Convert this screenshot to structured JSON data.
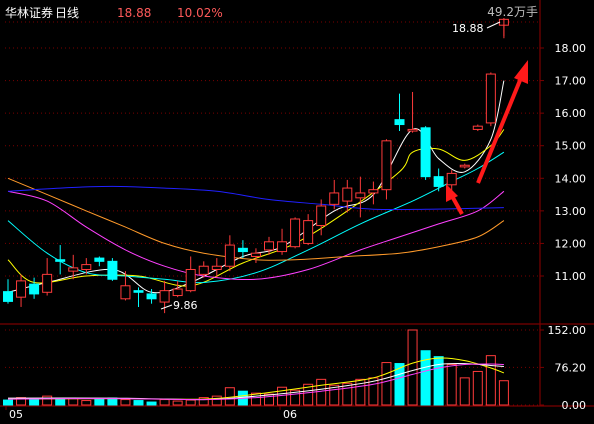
{
  "header": {
    "stock_name": "华林证券",
    "period": "日线",
    "price": "18.88",
    "change_pct": "10.02%",
    "volume_label": "49.2万手"
  },
  "colors": {
    "background": "#000000",
    "up": "#ff3b3b",
    "down": "#00ffff",
    "grid": "#7a0000",
    "axis_text": "#ffffff",
    "header_name": "#ffffff",
    "header_value": "#ff5a5a",
    "arrow": "#ff1a1a",
    "ma_fast": "#ffffff",
    "ma_yellow": "#ffff00",
    "ma_cyan": "#00ffff",
    "ma_magenta": "#ff40ff",
    "ma_orange": "#ff9a2a",
    "ma_blue": "#2020ff"
  },
  "chart_data": {
    "type": "candlestick",
    "price_axis": {
      "ticks": [
        "18.00",
        "17.00",
        "16.00",
        "15.00",
        "14.00",
        "13.00",
        "12.00",
        "11.00"
      ],
      "range": [
        10.0,
        19.0
      ]
    },
    "volume_axis": {
      "ticks": [
        "152.00",
        "76.20",
        "0.00"
      ],
      "range": [
        0,
        152
      ],
      "unit": "万手"
    },
    "x_labels": [
      {
        "text": "05",
        "index": 0
      },
      {
        "text": "06",
        "index": 21
      }
    ],
    "annotations": {
      "high_label": "18.88",
      "low_label": "9.86"
    },
    "candles": [
      {
        "o": 10.52,
        "h": 10.9,
        "l": 10.15,
        "c": 10.22,
        "v": 10
      },
      {
        "o": 10.35,
        "h": 11.05,
        "l": 10.05,
        "c": 10.85,
        "v": 15
      },
      {
        "o": 10.75,
        "h": 10.95,
        "l": 10.3,
        "c": 10.45,
        "v": 12
      },
      {
        "o": 10.5,
        "h": 11.55,
        "l": 10.4,
        "c": 11.05,
        "v": 18
      },
      {
        "o": 11.5,
        "h": 11.95,
        "l": 11.05,
        "c": 11.45,
        "v": 14
      },
      {
        "o": 11.15,
        "h": 11.65,
        "l": 10.9,
        "c": 11.25,
        "v": 13
      },
      {
        "o": 11.2,
        "h": 11.55,
        "l": 11.05,
        "c": 11.35,
        "v": 9
      },
      {
        "o": 11.55,
        "h": 11.6,
        "l": 11.3,
        "c": 11.45,
        "v": 12
      },
      {
        "o": 11.45,
        "h": 11.55,
        "l": 10.85,
        "c": 10.9,
        "v": 14
      },
      {
        "o": 10.3,
        "h": 11.15,
        "l": 10.25,
        "c": 10.7,
        "v": 11
      },
      {
        "o": 10.55,
        "h": 10.65,
        "l": 10.05,
        "c": 10.5,
        "v": 9
      },
      {
        "o": 10.45,
        "h": 10.6,
        "l": 10.15,
        "c": 10.3,
        "v": 6
      },
      {
        "o": 10.2,
        "h": 10.85,
        "l": 9.86,
        "c": 10.55,
        "v": 11
      },
      {
        "o": 10.4,
        "h": 10.85,
        "l": 10.35,
        "c": 10.6,
        "v": 8
      },
      {
        "o": 10.55,
        "h": 11.6,
        "l": 10.5,
        "c": 11.2,
        "v": 10
      },
      {
        "o": 11.05,
        "h": 11.45,
        "l": 10.95,
        "c": 11.3,
        "v": 15
      },
      {
        "o": 11.2,
        "h": 11.55,
        "l": 10.95,
        "c": 11.3,
        "v": 18
      },
      {
        "o": 11.3,
        "h": 12.25,
        "l": 11.15,
        "c": 11.95,
        "v": 35
      },
      {
        "o": 11.85,
        "h": 12.1,
        "l": 11.55,
        "c": 11.75,
        "v": 28
      },
      {
        "o": 11.6,
        "h": 11.85,
        "l": 11.4,
        "c": 11.7,
        "v": 24
      },
      {
        "o": 11.8,
        "h": 12.2,
        "l": 11.65,
        "c": 12.05,
        "v": 22
      },
      {
        "o": 11.75,
        "h": 12.45,
        "l": 11.65,
        "c": 12.05,
        "v": 36
      },
      {
        "o": 11.9,
        "h": 12.8,
        "l": 11.85,
        "c": 12.75,
        "v": 30
      },
      {
        "o": 12.0,
        "h": 12.9,
        "l": 11.95,
        "c": 12.7,
        "v": 42
      },
      {
        "o": 12.55,
        "h": 13.35,
        "l": 12.25,
        "c": 13.15,
        "v": 52
      },
      {
        "o": 13.2,
        "h": 13.95,
        "l": 13.05,
        "c": 13.55,
        "v": 40
      },
      {
        "o": 13.3,
        "h": 13.95,
        "l": 12.95,
        "c": 13.7,
        "v": 44
      },
      {
        "o": 13.4,
        "h": 14.05,
        "l": 12.8,
        "c": 13.55,
        "v": 52
      },
      {
        "o": 13.55,
        "h": 13.9,
        "l": 13.2,
        "c": 13.65,
        "v": 55
      },
      {
        "o": 13.65,
        "h": 15.2,
        "l": 13.35,
        "c": 15.15,
        "v": 86
      },
      {
        "o": 15.8,
        "h": 16.6,
        "l": 15.45,
        "c": 15.65,
        "v": 84
      },
      {
        "o": 15.45,
        "h": 16.65,
        "l": 15.4,
        "c": 15.5,
        "v": 152
      },
      {
        "o": 15.55,
        "h": 15.6,
        "l": 13.95,
        "c": 14.05,
        "v": 110
      },
      {
        "o": 14.05,
        "h": 14.3,
        "l": 13.6,
        "c": 13.75,
        "v": 98
      },
      {
        "o": 13.8,
        "h": 14.25,
        "l": 13.55,
        "c": 14.15,
        "v": 82
      },
      {
        "o": 14.35,
        "h": 14.45,
        "l": 14.3,
        "c": 14.4,
        "v": 55
      },
      {
        "o": 15.5,
        "h": 15.65,
        "l": 15.45,
        "c": 15.6,
        "v": 68
      },
      {
        "o": 15.7,
        "h": 17.25,
        "l": 15.6,
        "c": 17.2,
        "v": 100
      },
      {
        "o": 18.7,
        "h": 18.88,
        "l": 18.3,
        "c": 18.88,
        "v": 49.2
      }
    ],
    "moving_averages": [
      {
        "color_key": "ma_fast",
        "anchors": [
          [
            0,
            10.5
          ],
          [
            3,
            10.8
          ],
          [
            8,
            11.2
          ],
          [
            11,
            10.5
          ],
          [
            14,
            10.8
          ],
          [
            18,
            11.6
          ],
          [
            21,
            11.9
          ],
          [
            25,
            13.0
          ],
          [
            28,
            13.5
          ],
          [
            31,
            15.5
          ],
          [
            33,
            14.6
          ],
          [
            35,
            14.2
          ],
          [
            37,
            15.2
          ],
          [
            38,
            17.0
          ]
        ]
      },
      {
        "color_key": "ma_yellow",
        "anchors": [
          [
            0,
            11.5
          ],
          [
            2,
            10.8
          ],
          [
            6,
            11.0
          ],
          [
            10,
            11.0
          ],
          [
            14,
            10.7
          ],
          [
            18,
            11.4
          ],
          [
            22,
            12.0
          ],
          [
            26,
            13.0
          ],
          [
            30,
            14.2
          ],
          [
            31,
            14.8
          ],
          [
            33,
            14.9
          ],
          [
            35,
            14.55
          ],
          [
            37,
            15.0
          ],
          [
            38,
            15.5
          ]
        ]
      },
      {
        "color_key": "ma_cyan",
        "anchors": [
          [
            0,
            12.7
          ],
          [
            3,
            11.7
          ],
          [
            6,
            11.1
          ],
          [
            9,
            11.0
          ],
          [
            12,
            10.9
          ],
          [
            15,
            10.8
          ],
          [
            19,
            11.1
          ],
          [
            23,
            11.8
          ],
          [
            27,
            12.6
          ],
          [
            31,
            13.3
          ],
          [
            34,
            13.9
          ],
          [
            36,
            14.3
          ],
          [
            38,
            14.8
          ]
        ]
      },
      {
        "color_key": "ma_magenta",
        "anchors": [
          [
            0,
            13.6
          ],
          [
            3,
            13.3
          ],
          [
            6,
            12.5
          ],
          [
            9,
            11.8
          ],
          [
            12,
            11.3
          ],
          [
            15,
            11.0
          ],
          [
            19,
            10.9
          ],
          [
            23,
            11.2
          ],
          [
            27,
            11.8
          ],
          [
            30,
            12.2
          ],
          [
            33,
            12.6
          ],
          [
            36,
            13.0
          ],
          [
            38,
            13.6
          ]
        ]
      },
      {
        "color_key": "ma_orange",
        "anchors": [
          [
            0,
            14.0
          ],
          [
            3,
            13.5
          ],
          [
            6,
            13.0
          ],
          [
            9,
            12.5
          ],
          [
            12,
            12.0
          ],
          [
            15,
            11.7
          ],
          [
            19,
            11.5
          ],
          [
            22,
            11.5
          ],
          [
            26,
            11.6
          ],
          [
            30,
            11.7
          ],
          [
            33,
            11.9
          ],
          [
            36,
            12.2
          ],
          [
            38,
            12.7
          ]
        ]
      },
      {
        "color_key": "ma_blue",
        "anchors": [
          [
            0,
            13.6
          ],
          [
            4,
            13.7
          ],
          [
            8,
            13.75
          ],
          [
            12,
            13.7
          ],
          [
            16,
            13.6
          ],
          [
            20,
            13.35
          ],
          [
            24,
            13.2
          ],
          [
            28,
            13.05
          ],
          [
            32,
            13.05
          ],
          [
            36,
            13.08
          ],
          [
            38,
            13.1
          ]
        ]
      }
    ],
    "volume_mas": [
      {
        "color_key": "ma_yellow",
        "anchors": [
          [
            0,
            12
          ],
          [
            8,
            13
          ],
          [
            15,
            12
          ],
          [
            19,
            22
          ],
          [
            24,
            40
          ],
          [
            28,
            55
          ],
          [
            31,
            85
          ],
          [
            33,
            95
          ],
          [
            35,
            90
          ],
          [
            37,
            75
          ],
          [
            38,
            65
          ]
        ]
      },
      {
        "color_key": "ma_fast",
        "anchors": [
          [
            0,
            14
          ],
          [
            8,
            14
          ],
          [
            15,
            11
          ],
          [
            19,
            18
          ],
          [
            24,
            32
          ],
          [
            28,
            48
          ],
          [
            31,
            70
          ],
          [
            33,
            82
          ],
          [
            35,
            84
          ],
          [
            37,
            80
          ],
          [
            38,
            78
          ]
        ]
      },
      {
        "color_key": "ma_magenta",
        "anchors": [
          [
            0,
            12
          ],
          [
            8,
            13
          ],
          [
            15,
            11
          ],
          [
            19,
            15
          ],
          [
            24,
            28
          ],
          [
            28,
            42
          ],
          [
            31,
            62
          ],
          [
            33,
            75
          ],
          [
            35,
            82
          ],
          [
            37,
            83
          ],
          [
            38,
            82
          ]
        ]
      }
    ]
  }
}
